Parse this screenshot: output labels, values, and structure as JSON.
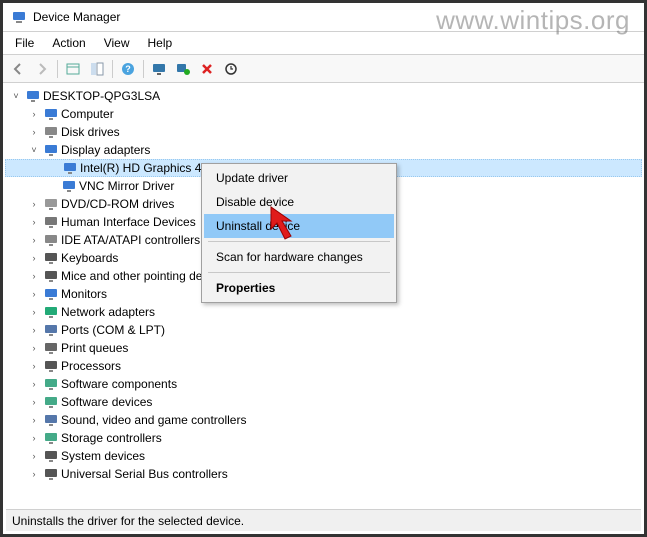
{
  "window": {
    "title": "Device Manager"
  },
  "watermark": "www.wintips.org",
  "menubar": [
    "File",
    "Action",
    "View",
    "Help"
  ],
  "root_name": "DESKTOP-QPG3LSA",
  "categories": [
    {
      "name": "Computer",
      "icon": "computer-icon",
      "expanded": false
    },
    {
      "name": "Disk drives",
      "icon": "disk-icon",
      "expanded": false
    },
    {
      "name": "Display adapters",
      "icon": "display-icon",
      "expanded": true,
      "children": [
        {
          "name": "Intel(R) HD Graphics 4600",
          "icon": "display-icon",
          "selected": true
        },
        {
          "name": "VNC Mirror Driver",
          "icon": "display-icon"
        }
      ]
    },
    {
      "name": "DVD/CD-ROM drives",
      "icon": "dvd-icon",
      "expanded": false
    },
    {
      "name": "Human Interface Devices",
      "icon": "hid-icon",
      "expanded": false
    },
    {
      "name": "IDE ATA/ATAPI controllers",
      "icon": "ide-icon",
      "expanded": false
    },
    {
      "name": "Keyboards",
      "icon": "keyboard-icon",
      "expanded": false
    },
    {
      "name": "Mice and other pointing devices",
      "icon": "mouse-icon",
      "expanded": false
    },
    {
      "name": "Monitors",
      "icon": "monitor-icon",
      "expanded": false
    },
    {
      "name": "Network adapters",
      "icon": "network-icon",
      "expanded": false
    },
    {
      "name": "Ports (COM & LPT)",
      "icon": "port-icon",
      "expanded": false
    },
    {
      "name": "Print queues",
      "icon": "printer-icon",
      "expanded": false
    },
    {
      "name": "Processors",
      "icon": "cpu-icon",
      "expanded": false
    },
    {
      "name": "Software components",
      "icon": "sw-comp-icon",
      "expanded": false
    },
    {
      "name": "Software devices",
      "icon": "sw-dev-icon",
      "expanded": false
    },
    {
      "name": "Sound, video and game controllers",
      "icon": "sound-icon",
      "expanded": false
    },
    {
      "name": "Storage controllers",
      "icon": "storage-icon",
      "expanded": false
    },
    {
      "name": "System devices",
      "icon": "system-icon",
      "expanded": false
    },
    {
      "name": "Universal Serial Bus controllers",
      "icon": "usb-icon",
      "expanded": false
    }
  ],
  "context_menu": {
    "items": [
      {
        "label": "Update driver"
      },
      {
        "label": "Disable device"
      },
      {
        "label": "Uninstall device",
        "highlight": true
      },
      {
        "sep": true
      },
      {
        "label": "Scan for hardware changes"
      },
      {
        "sep": true
      },
      {
        "label": "Properties",
        "bold": true
      }
    ]
  },
  "statusbar": "Uninstalls the driver for the selected device.",
  "toolbar_buttons": [
    "back-icon",
    "forward-icon",
    "sep",
    "show-hidden-icon",
    "tree-icon",
    "sep",
    "help-icon",
    "sep",
    "monitor-icon",
    "scan-icon",
    "uninstall-icon",
    "update-icon"
  ]
}
